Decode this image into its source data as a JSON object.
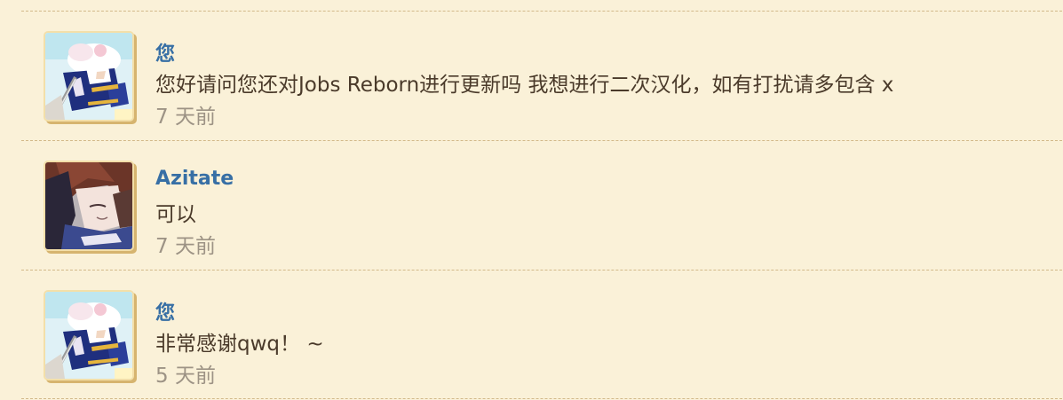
{
  "messages": [
    {
      "author": "您",
      "text": "您好请问您还对Jobs Reborn进行更新吗 我想进行二次汉化，如有打扰请多包含 x",
      "time": "7 天前",
      "avatar_icon": "anime-girl-white-hair-avatar"
    },
    {
      "author": "Azitate",
      "text": "可以",
      "time": "7 天前",
      "avatar_icon": "anime-girl-red-hair-avatar"
    },
    {
      "author": "您",
      "text": "非常感谢qwq！ ~",
      "time": "5 天前",
      "avatar_icon": "anime-girl-white-hair-avatar"
    }
  ],
  "colors": {
    "background": "#faf1d8",
    "author": "#376fa5",
    "text": "#4a3a2a",
    "time": "#9d9385",
    "divider": "#d2b98a"
  }
}
